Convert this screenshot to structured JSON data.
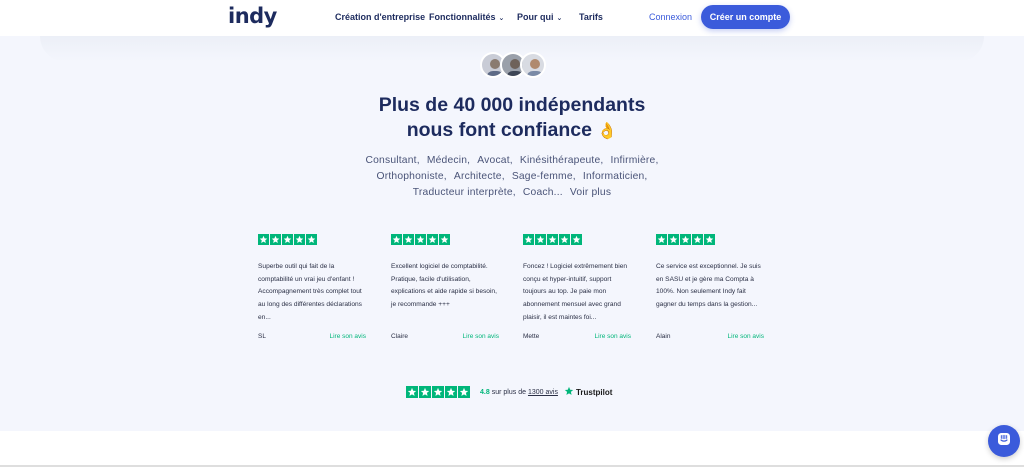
{
  "header": {
    "logo": "indy",
    "nav": [
      {
        "label": "Création d'entreprise"
      },
      {
        "label": "Fonctionnalités"
      },
      {
        "label": "Pour qui"
      },
      {
        "label": "Tarifs"
      }
    ],
    "login_label": "Connexion",
    "cta_label": "Créer un compte"
  },
  "hero": {
    "headline_line1": "Plus de 40 000 indépendants",
    "headline_line2": "nous font confiance",
    "emoji": "👌",
    "professions_line1": [
      "Consultant,",
      "Médecin,",
      "Avocat,",
      "Kinésithérapeute,",
      "Infirmière,"
    ],
    "professions_line2": [
      "Orthophoniste,",
      "Architecte,",
      "Sage-femme,",
      "Informaticien,"
    ],
    "professions_line3": [
      "Traducteur interprète,",
      "Coach..."
    ],
    "see_more": "Voir plus"
  },
  "reviews": [
    {
      "text": "Superbe outil qui fait de la comptabilité un vrai jeu d'enfant ! Accompagnement très complet tout au long des différentes déclarations en...",
      "author": "SL",
      "link": "Lire son avis",
      "rating": 5
    },
    {
      "text": "Excellent logiciel de comptabilité. Pratique, facile d'utilisation, explications et aide rapide si besoin, je recommande +++",
      "author": "Claire",
      "link": "Lire son avis",
      "rating": 5
    },
    {
      "text": "Foncez ! Logiciel extrêmement bien conçu et hyper-intuitif, support toujours au top. Je paie mon abonnement mensuel avec grand plaisir, il est maintes foi...",
      "author": "Mette",
      "link": "Lire son avis",
      "rating": 5
    },
    {
      "text": "Ce service est exceptionnel. Je suis en SASU et je gère ma Compta à 100%. Non seulement Indy fait gagner du temps dans la gestion...",
      "author": "Alain",
      "link": "Lire son avis",
      "rating": 5
    }
  ],
  "trustpilot": {
    "rating": "4.8",
    "text": "sur plus de",
    "count": "1300 avis",
    "brand": "Trustpilot"
  },
  "colors": {
    "brand": "#1d2b5e",
    "accent": "#3b5bdb",
    "trustpilot_green": "#00b67a",
    "section_bg": "#f4f6fd"
  },
  "icons": {
    "chat": "chat-bubble-icon",
    "star": "star-icon"
  }
}
